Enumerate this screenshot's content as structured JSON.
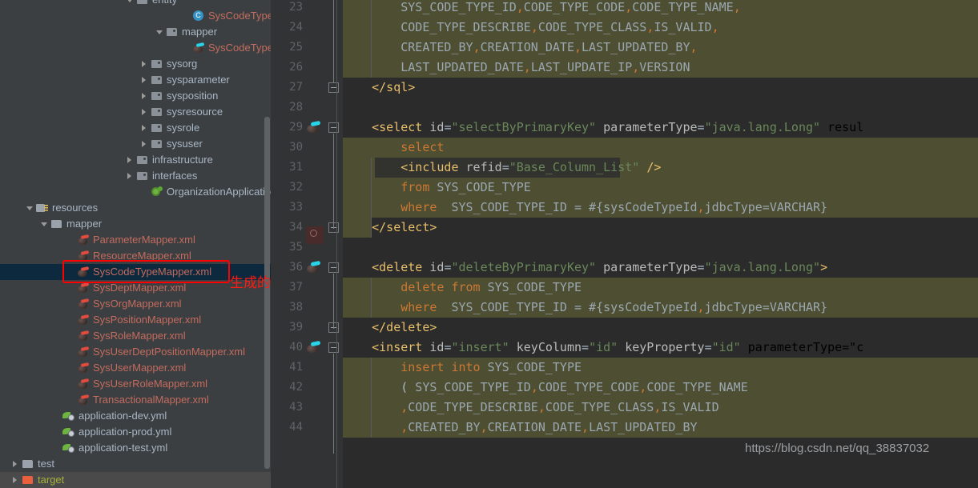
{
  "tree": {
    "items": [
      {
        "label": "entity",
        "icon": "package-folder-icon",
        "indent": 158,
        "arrow": "down",
        "color": "c-normal",
        "partial": true
      },
      {
        "label": "SysCodeType",
        "icon": "class-icon",
        "indent": 228,
        "arrow": "none",
        "color": "c-file"
      },
      {
        "label": "mapper",
        "icon": "package-folder-icon",
        "indent": 195,
        "arrow": "down",
        "color": "c-normal"
      },
      {
        "label": "SysCodeTypeMa",
        "icon": "mybatis-icon",
        "indent": 228,
        "arrow": "none",
        "color": "c-file"
      },
      {
        "label": "sysorg",
        "icon": "package-folder-icon",
        "indent": 176,
        "arrow": "right",
        "color": "c-normal"
      },
      {
        "label": "sysparameter",
        "icon": "package-folder-icon",
        "indent": 176,
        "arrow": "right",
        "color": "c-normal"
      },
      {
        "label": "sysposition",
        "icon": "package-folder-icon",
        "indent": 176,
        "arrow": "right",
        "color": "c-normal"
      },
      {
        "label": "sysresource",
        "icon": "package-folder-icon",
        "indent": 176,
        "arrow": "right",
        "color": "c-normal"
      },
      {
        "label": "sysrole",
        "icon": "package-folder-icon",
        "indent": 176,
        "arrow": "right",
        "color": "c-normal"
      },
      {
        "label": "sysuser",
        "icon": "package-folder-icon",
        "indent": 176,
        "arrow": "right",
        "color": "c-normal"
      },
      {
        "label": "infrastructure",
        "icon": "package-folder-icon",
        "indent": 158,
        "arrow": "right",
        "color": "c-normal"
      },
      {
        "label": "interfaces",
        "icon": "package-folder-icon",
        "indent": 158,
        "arrow": "right",
        "color": "c-normal"
      },
      {
        "label": "OrganizationApplication",
        "icon": "spring-boot-icon",
        "indent": 176,
        "arrow": "none",
        "color": "c-normal"
      },
      {
        "label": "resources",
        "icon": "resources-folder-icon",
        "indent": 33,
        "arrow": "down",
        "color": "c-normal"
      },
      {
        "label": "mapper",
        "icon": "folder-icon",
        "indent": 51,
        "arrow": "down",
        "color": "c-normal"
      },
      {
        "label": "ParameterMapper.xml",
        "icon": "mybatis-xml-icon",
        "indent": 84,
        "arrow": "none",
        "color": "c-file"
      },
      {
        "label": "ResourceMapper.xml",
        "icon": "mybatis-xml-icon",
        "indent": 84,
        "arrow": "none",
        "color": "c-file"
      },
      {
        "label": "SysCodeTypeMapper.xml",
        "icon": "mybatis-xml-icon",
        "indent": 84,
        "arrow": "none",
        "color": "c-file",
        "selected": true
      },
      {
        "label": "SysDeptMapper.xml",
        "icon": "mybatis-xml-icon",
        "indent": 84,
        "arrow": "none",
        "color": "c-file"
      },
      {
        "label": "SysOrgMapper.xml",
        "icon": "mybatis-xml-icon",
        "indent": 84,
        "arrow": "none",
        "color": "c-file"
      },
      {
        "label": "SysPositionMapper.xml",
        "icon": "mybatis-xml-icon",
        "indent": 84,
        "arrow": "none",
        "color": "c-file"
      },
      {
        "label": "SysRoleMapper.xml",
        "icon": "mybatis-xml-icon",
        "indent": 84,
        "arrow": "none",
        "color": "c-file"
      },
      {
        "label": "SysUserDeptPositionMapper.xml",
        "icon": "mybatis-xml-icon",
        "indent": 84,
        "arrow": "none",
        "color": "c-file"
      },
      {
        "label": "SysUserMapper.xml",
        "icon": "mybatis-xml-icon",
        "indent": 84,
        "arrow": "none",
        "color": "c-file"
      },
      {
        "label": "SysUserRoleMapper.xml",
        "icon": "mybatis-xml-icon",
        "indent": 84,
        "arrow": "none",
        "color": "c-file"
      },
      {
        "label": "TransactionalMapper.xml",
        "icon": "mybatis-xml-icon",
        "indent": 84,
        "arrow": "none",
        "color": "c-file"
      },
      {
        "label": "application-dev.yml",
        "icon": "yml-icon",
        "indent": 66,
        "arrow": "none",
        "color": "c-normal"
      },
      {
        "label": "application-prod.yml",
        "icon": "yml-icon",
        "indent": 66,
        "arrow": "none",
        "color": "c-normal"
      },
      {
        "label": "application-test.yml",
        "icon": "yml-icon",
        "indent": 66,
        "arrow": "none",
        "color": "c-normal"
      },
      {
        "label": "test",
        "icon": "folder-icon",
        "indent": 15,
        "arrow": "right",
        "color": "c-normal"
      },
      {
        "label": "target",
        "icon": "orange-folder-icon",
        "indent": 15,
        "arrow": "right",
        "color": "c-target",
        "gray": true
      }
    ]
  },
  "annotation": {
    "text": "生成的xml文件包含此表常用的增删改查对应的sql",
    "color": "#ff1a12"
  },
  "watermark": {
    "text": "https://blog.csdn.net/qq_38837032"
  },
  "editor": {
    "line_numbers": [
      "23",
      "24",
      "25",
      "26",
      "27",
      "28",
      "29",
      "30",
      "31",
      "32",
      "33",
      "34",
      "35",
      "36",
      "37",
      "38",
      "39",
      "40",
      "41",
      "42",
      "43",
      "44"
    ],
    "lines": [
      {
        "n": "23",
        "text": "        SYS_CODE_TYPE_ID,CODE_TYPE_CODE,CODE_TYPE_NAME,",
        "bg": "olive"
      },
      {
        "n": "24",
        "text": "        CODE_TYPE_DESCRIBE,CODE_TYPE_CLASS,IS_VALID,",
        "bg": "olive"
      },
      {
        "n": "25",
        "text": "        CREATED_BY,CREATION_DATE,LAST_UPDATED_BY,",
        "bg": "olive"
      },
      {
        "n": "26",
        "text": "        LAST_UPDATED_DATE,LAST_UPDATE_IP,VERSION",
        "bg": "olive"
      },
      {
        "n": "27",
        "text": "    </sql>",
        "bg": "dark"
      },
      {
        "n": "28",
        "text": "",
        "bg": "dark"
      },
      {
        "n": "29",
        "text": "    <select id=\"selectByPrimaryKey\" parameterType=\"java.lang.Long\" resul",
        "bg": "dark"
      },
      {
        "n": "30",
        "text": "        select",
        "bg": "olive"
      },
      {
        "n": "31",
        "text": "        <include refid=\"Base_Column_List\" />",
        "bg": "olive"
      },
      {
        "n": "32",
        "text": "        from SYS_CODE_TYPE",
        "bg": "olive"
      },
      {
        "n": "33",
        "text": "        where  SYS_CODE_TYPE_ID = #{sysCodeTypeId,jdbcType=VARCHAR}",
        "bg": "olive"
      },
      {
        "n": "34",
        "text": "    </select>",
        "bg": "dark"
      },
      {
        "n": "35",
        "text": "",
        "bg": "dark"
      },
      {
        "n": "36",
        "text": "    <delete id=\"deleteByPrimaryKey\" parameterType=\"java.lang.Long\">",
        "bg": "dark"
      },
      {
        "n": "37",
        "text": "        delete from SYS_CODE_TYPE",
        "bg": "olive"
      },
      {
        "n": "38",
        "text": "        where  SYS_CODE_TYPE_ID = #{sysCodeTypeId,jdbcType=VARCHAR}",
        "bg": "olive"
      },
      {
        "n": "39",
        "text": "    </delete>",
        "bg": "dark"
      },
      {
        "n": "40",
        "text": "    <insert id=\"insert\" keyColumn=\"id\" keyProperty=\"id\" parameterType=\"c",
        "bg": "dark"
      },
      {
        "n": "41",
        "text": "        insert into SYS_CODE_TYPE",
        "bg": "olive"
      },
      {
        "n": "42",
        "text": "        ( SYS_CODE_TYPE_ID,CODE_TYPE_CODE,CODE_TYPE_NAME",
        "bg": "olive"
      },
      {
        "n": "43",
        "text": "        ,CODE_TYPE_DESCRIBE,CODE_TYPE_CLASS,IS_VALID",
        "bg": "olive"
      },
      {
        "n": "44",
        "text": "        ,CREATED_BY,CREATION_DATE,LAST_UPDATED_BY",
        "bg": "olive"
      }
    ]
  },
  "colors": {
    "background": "#3c3f41",
    "editor_background": "#2b2b2b",
    "gutter": "#313335",
    "selection_block": "#4e4f32",
    "tree_selection": "#0d293e",
    "annotation_red": "#ff0000",
    "tag": "#e8bf6a",
    "attr_value": "#6a8759",
    "keyword": "#cc7832"
  }
}
